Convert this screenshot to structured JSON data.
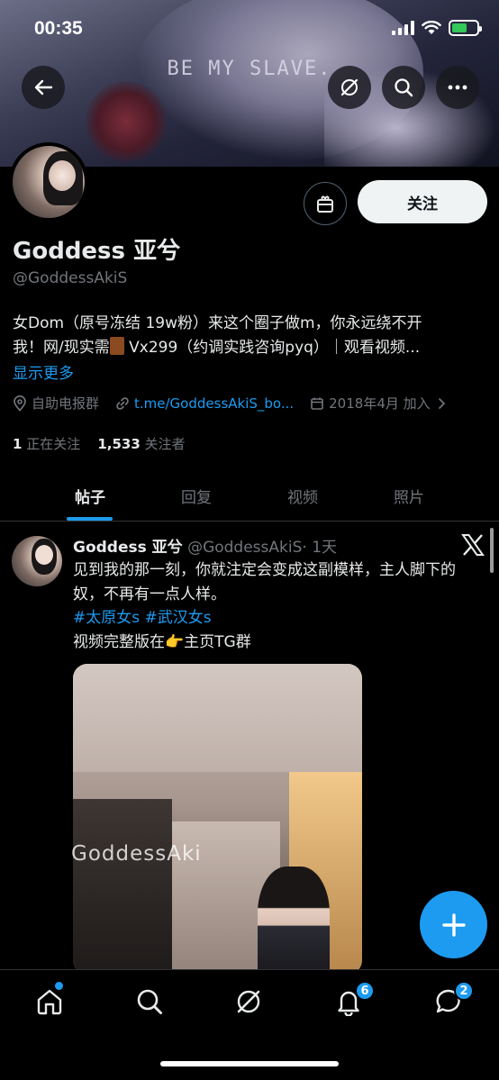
{
  "status_bar": {
    "time": "00:35"
  },
  "banner": {
    "text": "BE MY SLAVE."
  },
  "profile": {
    "name": "Goddess 亚兮",
    "handle": "@GoddessAkiS",
    "follow_label": "关注",
    "bio_line1": "女Dom（原号冻结 19w粉）来这个圈子做m，你永远绕不开",
    "bio_line2_a": "我！网/现实需",
    "bio_line2_b": "Vx299（约调实践咨询pyq）｜观看视频...",
    "show_more": "显示更多",
    "location": "自助电报群",
    "link": "t.me/GoddessAkiS_bo...",
    "joined": "2018年4月 加入",
    "following_count": "1",
    "following_label": "正在关注",
    "followers_count": "1,533",
    "followers_label": "关注者"
  },
  "tabs": [
    {
      "label": "帖子"
    },
    {
      "label": "回复"
    },
    {
      "label": "视频"
    },
    {
      "label": "照片"
    }
  ],
  "post": {
    "name": "Goddess 亚兮",
    "handle": "@GoddessAkiS",
    "time": "· 1天",
    "text": "见到我的那一刻，你就注定会变成这副模样，主人脚下的奴，不再有一点人样。",
    "hashtag1": "#太原女s",
    "hashtag2": "#武汉女s",
    "line3_a": "视频完整版在",
    "line3_b": "主页TG群",
    "media_watermark": "GoddessAki"
  },
  "nav": {
    "notifications_badge": "6",
    "messages_badge": "2"
  },
  "colors": {
    "accent": "#1d9bf0",
    "background": "#000000",
    "text": "#e7e9ea",
    "muted": "#71767b"
  }
}
